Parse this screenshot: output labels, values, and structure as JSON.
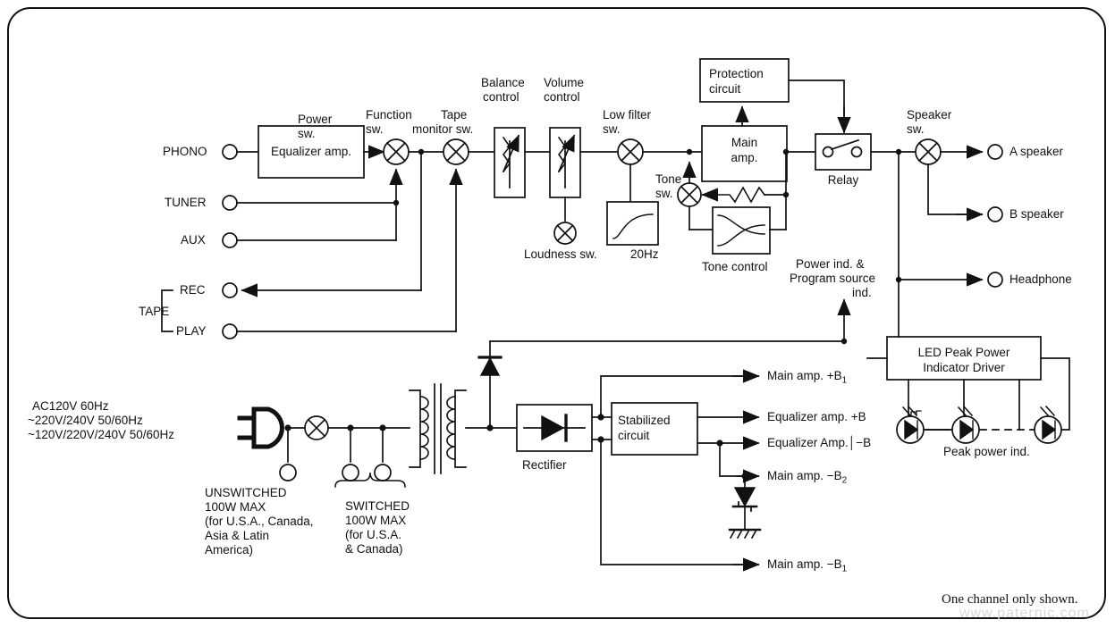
{
  "diagram": {
    "title": "Stereo amplifier signal-flow block diagram",
    "caption": "One channel only shown.",
    "watermark": "www.paternic.com"
  },
  "inputs": [
    {
      "id": "phono",
      "label": "PHONO"
    },
    {
      "id": "tuner",
      "label": "TUNER"
    },
    {
      "id": "aux",
      "label": "AUX"
    }
  ],
  "tape": {
    "group_label": "TAPE",
    "rec_label": "REC",
    "play_label": "PLAY"
  },
  "blocks": {
    "equalizer_amp": "Equalizer amp.",
    "protection_circuit_l1": "Protection",
    "protection_circuit_l2": "circuit",
    "main_amp_l1": "Main",
    "main_amp_l2": "amp.",
    "relay": "Relay",
    "tone_control": "Tone control",
    "rectifier": "Rectifier",
    "stabilized_l1": "Stabilized",
    "stabilized_l2": "circuit",
    "led_driver_l1": "LED Peak Power",
    "led_driver_l2": "Indicator Driver",
    "peak_power_ind": "Peak power ind."
  },
  "switches": {
    "function_l1": "Function",
    "function_l2": "sw.",
    "tape_monitor_l1": "Tape",
    "tape_monitor_l2": "monitor sw.",
    "balance_l1": "Balance",
    "balance_l2": "control",
    "volume_l1": "Volume",
    "volume_l2": "control",
    "loudness": "Loudness sw.",
    "low_filter_l1": "Low filter",
    "low_filter_l2": "sw.",
    "low_filter_freq": "20Hz",
    "tone_l1": "Tone",
    "tone_l2": "sw.",
    "speaker_l1": "Speaker",
    "speaker_l2": "sw.",
    "power_l1": "Power",
    "power_l2": "sw."
  },
  "outputs": [
    {
      "id": "a-speaker",
      "label": "A speaker"
    },
    {
      "id": "b-speaker",
      "label": "B speaker"
    },
    {
      "id": "headphone",
      "label": "Headphone"
    }
  ],
  "indicator_label": {
    "line1": "Power ind. &",
    "line2": "Program source",
    "line3": "ind."
  },
  "power_supply": {
    "voltage_l1": "AC120V 60Hz",
    "voltage_l2": "~220V/240V 50/60Hz",
    "voltage_l3": "~120V/220V/240V 50/60Hz",
    "unswitched": [
      "UNSWITCHED",
      "100W MAX",
      "(for U.S.A., Canada,",
      "Asia & Latin",
      "America)"
    ],
    "switched": [
      "SWITCHED",
      "100W MAX",
      "(for U.S.A.",
      "& Canada)"
    ]
  },
  "rails": [
    {
      "id": "main-amp-plus-b1",
      "text": "Main amp. +B",
      "sub": "1"
    },
    {
      "id": "equalizer-amp-plus-b",
      "text": "Equalizer amp. +B",
      "sub": ""
    },
    {
      "id": "equalizer-amp-minus-b",
      "text": "Equalizer Amp.│−B",
      "sub": ""
    },
    {
      "id": "main-amp-minus-b2",
      "text": "Main amp. −B",
      "sub": "2"
    },
    {
      "id": "main-amp-minus-b1",
      "text": "Main amp. −B",
      "sub": "1"
    }
  ],
  "colors": {
    "ink": "#111111",
    "paper": "#ffffff",
    "watermark": "#d8d8d8"
  }
}
